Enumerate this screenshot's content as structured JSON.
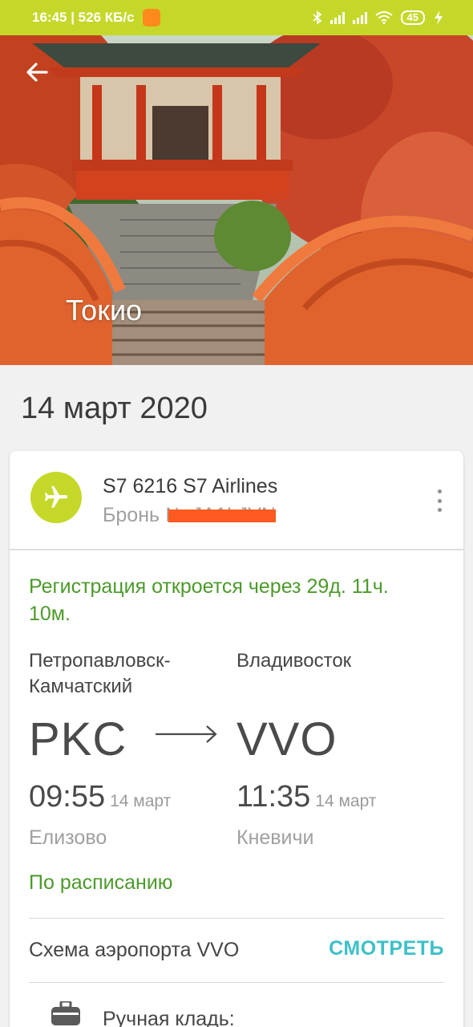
{
  "status_bar": {
    "time_speed": "16:45 | 526 КБ/с",
    "battery": "45"
  },
  "hero": {
    "city": "Токио"
  },
  "trip": {
    "date": "14 март 2020"
  },
  "flight": {
    "title": "S7 6216 S7 Airlines",
    "booking_prefix": "Бронь № JA1LJVN",
    "checkin_notice": "Регистрация откроется через 29д. 11ч. 10м.",
    "from": {
      "city": "Петропавловск-Камчатский",
      "code": "PKC",
      "time": "09:55",
      "date": "14 март",
      "airport": "Елизово"
    },
    "to": {
      "city": "Владивосток",
      "code": "VVO",
      "time": "11:35",
      "date": "14 март",
      "airport": "Кневичи"
    },
    "status": "По расписанию",
    "airport_map_label": "Схема аэропорта VVO",
    "view_label": "СМОТРЕТЬ",
    "baggage_label": "Ручная кладь:"
  },
  "colors": {
    "accent": "#c5d82a",
    "status_green": "#4c9a2a",
    "link_teal": "#3ec0c8",
    "redaction": "#ff5a1f"
  },
  "icons": [
    "back-arrow-icon",
    "plane-icon",
    "more-vert-icon",
    "route-arrow-icon",
    "luggage-icon",
    "bluetooth-icon",
    "signal-icon",
    "wifi-icon",
    "battery-icon",
    "charging-icon"
  ]
}
